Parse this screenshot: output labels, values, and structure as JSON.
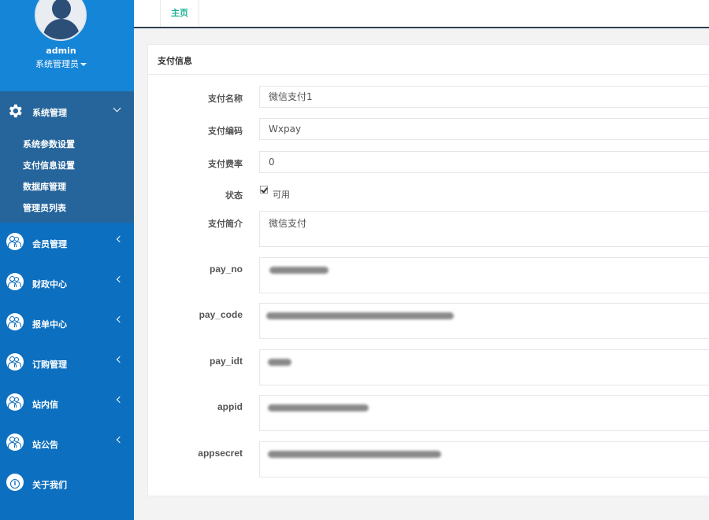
{
  "profile": {
    "username": "admin",
    "role": "系统管理员"
  },
  "sidebar": {
    "open_group": {
      "label": "系统管理",
      "items": [
        "系统参数设置",
        "支付信息设置",
        "数据库管理",
        "管理员列表"
      ]
    },
    "groups": [
      {
        "label": "会员管理",
        "icon": "users-icon"
      },
      {
        "label": "财政中心",
        "icon": "users-icon"
      },
      {
        "label": "报单中心",
        "icon": "users-icon"
      },
      {
        "label": "订购管理",
        "icon": "users-icon"
      },
      {
        "label": "站内信",
        "icon": "users-icon"
      },
      {
        "label": "站公告",
        "icon": "users-icon"
      },
      {
        "label": "关于我们",
        "icon": "info-icon"
      }
    ]
  },
  "tabs": {
    "home": "主页"
  },
  "panel": {
    "title": "支付信息",
    "fields": {
      "name": {
        "label": "支付名称",
        "value": "微信支付1"
      },
      "code": {
        "label": "支付编码",
        "value": "Wxpay"
      },
      "rate": {
        "label": "支付费率",
        "value": "0"
      },
      "status": {
        "label": "状态",
        "option": "可用",
        "checked": true
      },
      "intro": {
        "label": "支付简介",
        "value": "微信支付"
      },
      "pay_no": {
        "label": "pay_no"
      },
      "pay_code": {
        "label": "pay_code"
      },
      "pay_idt": {
        "label": "pay_idt"
      },
      "appid": {
        "label": "appid"
      },
      "appsecret": {
        "label": "appsecret"
      }
    }
  },
  "colors": {
    "sidebar": "#0d6fbf",
    "sidebar_profile": "#1585d8",
    "sidebar_open_group": "#26659b",
    "accent": "#1ab394",
    "topbar_border": "#2f4050"
  }
}
